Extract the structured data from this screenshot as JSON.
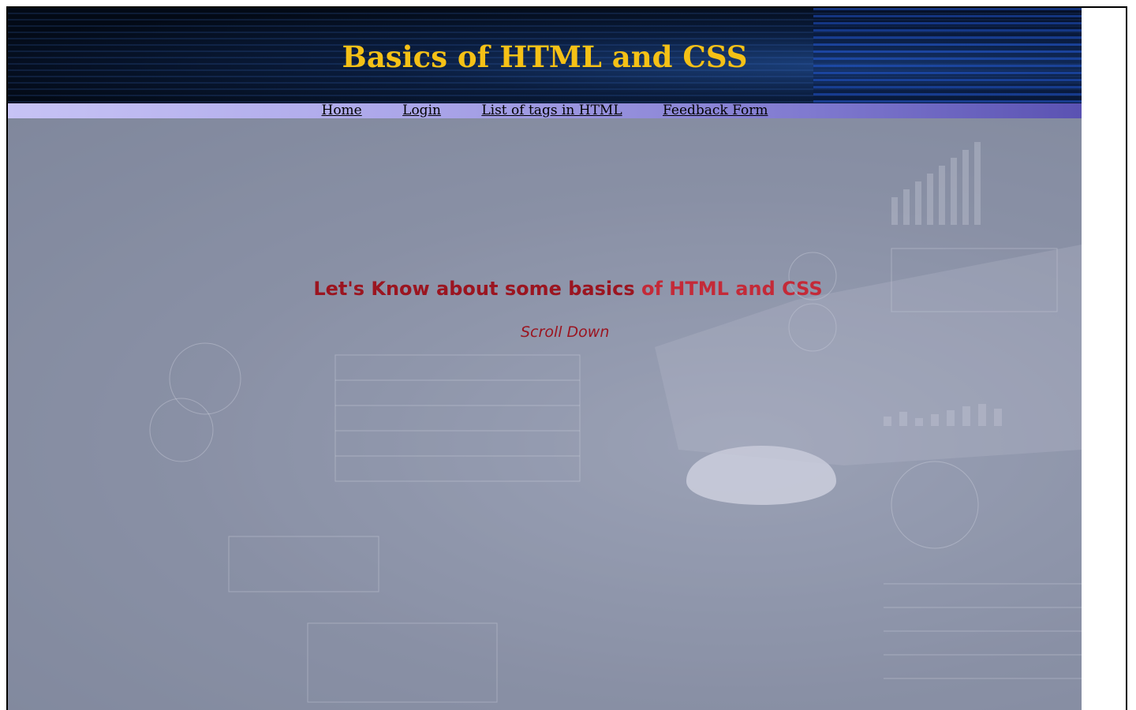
{
  "header": {
    "title": "Basics of HTML and CSS"
  },
  "nav": {
    "items": [
      {
        "label": "Home"
      },
      {
        "label": "Login"
      },
      {
        "label": "List of tags in HTML"
      },
      {
        "label": "Feedback Form"
      }
    ]
  },
  "hero": {
    "heading_part1": "Let's Know about some basics",
    "heading_part2": " of HTML and CSS",
    "scroll_hint": "Scroll Down"
  },
  "colors": {
    "title": "#f5c116",
    "heading": "#9b1520",
    "nav_start": "#c7c3f5",
    "nav_end": "#5a52b2"
  }
}
